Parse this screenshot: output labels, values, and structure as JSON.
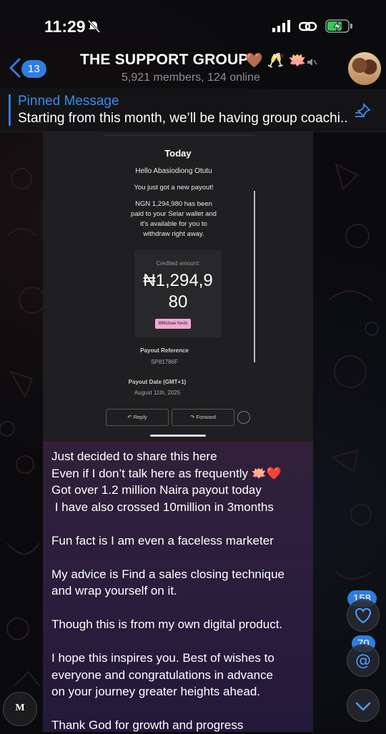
{
  "status_bar": {
    "time": "11:29"
  },
  "header": {
    "back_count": "13",
    "title": "THE SUPPORT GROUP",
    "title_emojis": "🤎 🥂 🪷",
    "subtitle": "5,921 members, 124 online"
  },
  "pinned": {
    "label": "Pinned Message",
    "text": "Starting from this month, we’ll be having group coachi.."
  },
  "email_screenshot": {
    "date_header": "Today",
    "greeting": "Hello Abasiodiong Otutu",
    "line1": "You just got a new payout!",
    "body_lines": [
      "NGN 1,294,980 has been",
      "paid to your Selar wallet and",
      "it's available for you to",
      "withdraw right away."
    ],
    "credited_label": "Credited amount:",
    "credited_amount_line1": "₦1,294,9",
    "credited_amount_line2": "80",
    "withdraw_button": "Withdraw funds",
    "payout_reference_label": "Payout Reference",
    "payout_reference_value": "SP81786F",
    "payout_date_label": "Payout Date (GMT+1)",
    "payout_date_value": "August 11th, 2025",
    "reply_button": "Reply",
    "forward_button": "Forward"
  },
  "message": {
    "text": "Just decided to share this here\nEven if I don’t talk here as frequently 🪷❤️\nGot over 1.2 million Naira payout today\n I have also crossed 10million in 3months\n\nFun fact is I am even a faceless marketer\n\nMy advice is Find a sales closing technique\nand wrap yourself on it.\n\nThough this is from my own digital product.\n\nI hope this inspires you. Best of wishes to\neveryone and congratulations in advance\non your journey greater heights ahead.\n\nThank God for growth and progress"
  },
  "side_controls": {
    "reactions_count": "158",
    "mentions_count": "70"
  },
  "logo_text": "M",
  "colors": {
    "accent": "#2f7de1",
    "bubble": "#2d1e3b"
  }
}
